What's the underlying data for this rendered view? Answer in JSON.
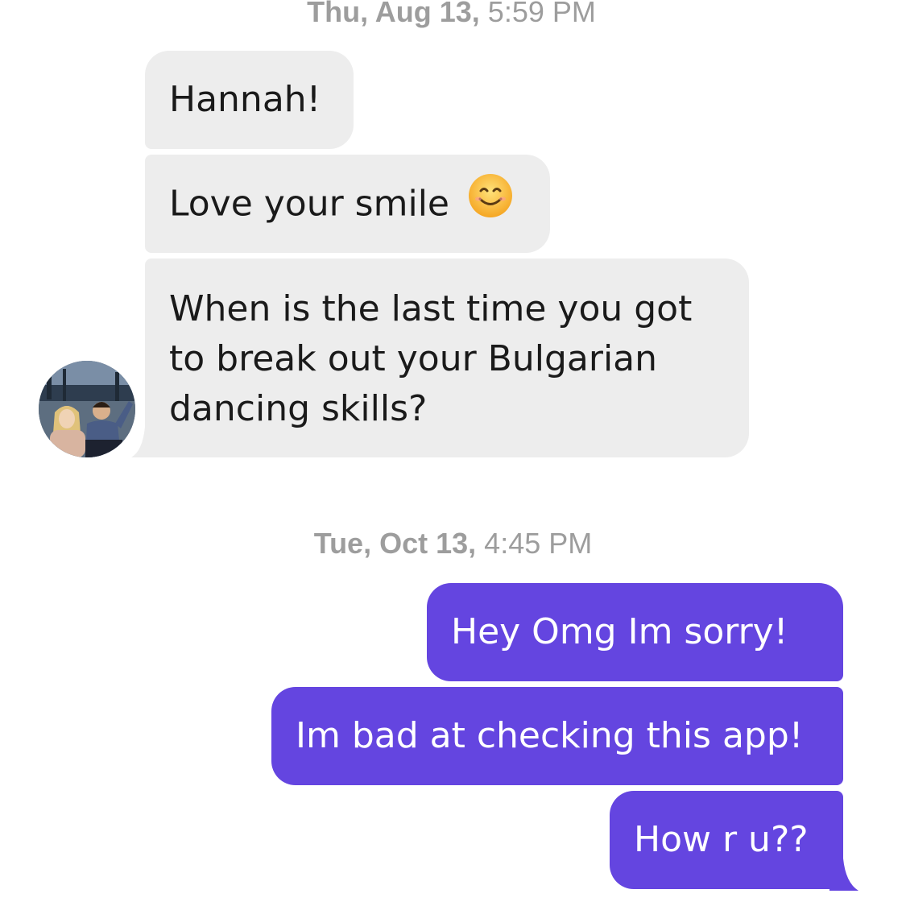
{
  "thread": {
    "groups": [
      {
        "timestamp_day": "Thu, Aug 13,",
        "timestamp_time": "5:59 PM",
        "direction": "incoming",
        "messages": [
          {
            "text": "Hannah!"
          },
          {
            "text": "Love your smile",
            "emoji": "smiling-face-icon"
          },
          {
            "lines": [
              "When is the last time you got",
              "to break out your Bulgarian",
              "dancing skills?"
            ]
          }
        ]
      },
      {
        "timestamp_day": "Tue, Oct 13,",
        "timestamp_time": "4:45 PM",
        "direction": "outgoing",
        "messages": [
          {
            "text": "Hey Omg Im sorry!"
          },
          {
            "text": "Im bad at checking this app!"
          },
          {
            "text": "How r u??"
          }
        ]
      }
    ]
  },
  "colors": {
    "incoming_bubble": "#ededed",
    "outgoing_bubble": "#6445e0",
    "timestamp": "#9d9d9d"
  }
}
